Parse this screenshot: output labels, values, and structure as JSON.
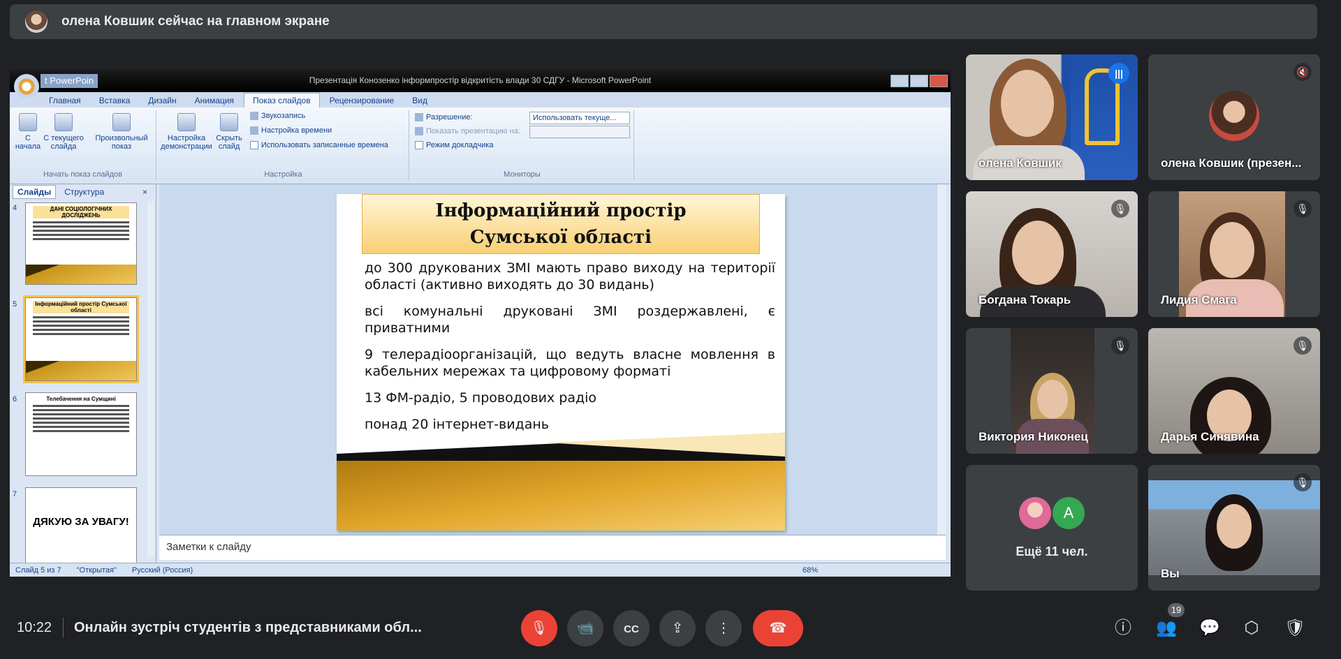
{
  "banner": {
    "text": "олена Ковшик сейчас на главном экране"
  },
  "ppt": {
    "quick_access": "t PowerPoin",
    "window_title": "Презентація Конозенко інформпростір відкритість влади 30 СДГУ - Microsoft PowerPoint",
    "tabs": [
      "Главная",
      "Вставка",
      "Дизайн",
      "Анимация",
      "Показ слайдов",
      "Рецензирование",
      "Вид"
    ],
    "ribbon": {
      "from_start": "С начала",
      "from_current": "С текущего слайда",
      "custom_show": "Произвольный показ",
      "group_start": "Начать показ слайдов",
      "setup_show": "Настройка демонстрации",
      "hide_slide": "Скрыть слайд",
      "record_sound": "Звукозапись",
      "rehearse": "Настройка времени",
      "use_timings": "Использовать записанные времена",
      "group_setup": "Настройка",
      "resolution_label": "Разрешение:",
      "resolution_value": "Использовать текуще...",
      "show_on_label": "Показать презентацию на:",
      "presenter_view": "Режим докладчика",
      "group_monitors": "Мониторы"
    },
    "panel_tabs": [
      "Слайды",
      "Структура"
    ],
    "thumbs": [
      {
        "num": "4",
        "title": "ДАНІ СОЦІОЛОГІЧНИХ ДОСЛІДЖЕНЬ"
      },
      {
        "num": "5",
        "title": "Інформаційний простір Сумської області"
      },
      {
        "num": "6",
        "title": "Телебачення на Сумщині"
      },
      {
        "num": "7",
        "title": "ДЯКУЮ ЗА УВАГУ!"
      }
    ],
    "slide": {
      "title_line1": "Інформаційний простір",
      "title_line2": "Сумської області",
      "bullets": [
        "до 300 друкованих ЗМІ мають право виходу на території області (активно виходять до 30 видань)",
        "всі комунальні друковані ЗМІ роздержавлені, є приватними",
        "9 телерадіоорганізацій, що ведуть власне мовлення в кабельних мережах та цифровому форматі",
        "13 ФМ-радіо, 5 проводових радіо",
        "понад 20 інтернет-видань"
      ]
    },
    "notes_placeholder": "Заметки к слайду",
    "status": {
      "slide": "Слайд 5 из 7",
      "theme": "\"Открытая\"",
      "language": "Русский (Россия)",
      "zoom": "68%"
    }
  },
  "participants": [
    {
      "name": "олена Ковшик"
    },
    {
      "name": "олена Ковшик (презен..."
    },
    {
      "name": "Богдана Токарь"
    },
    {
      "name": "Лидия Смага"
    },
    {
      "name": "Виктория Никонец"
    },
    {
      "name": "Дарья Синявина"
    },
    {
      "name": "Ещё 11 чел.",
      "avatar_letter": "A"
    },
    {
      "name": "Вы"
    }
  ],
  "bottom": {
    "time": "10:22",
    "meeting_title": "Онлайн зустріч студентів з представниками обл...",
    "people_count": "19"
  },
  "colors": {
    "end_call": "#ea4335",
    "speaking": "#1a73e8",
    "bg": "#202124"
  }
}
